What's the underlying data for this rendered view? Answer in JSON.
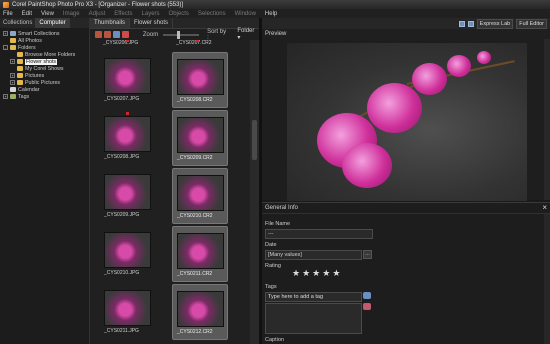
{
  "window": {
    "title": "Corel PaintShop Photo Pro X3 - [Organizer - Flower shots (553)]"
  },
  "menu": [
    "File",
    "Edit",
    "View",
    "Image",
    "Adjust",
    "Effects",
    "Layers",
    "Objects",
    "Selections",
    "Window",
    "Help"
  ],
  "left_panel": {
    "tabs": [
      "Collections",
      "Computer"
    ],
    "tree": [
      {
        "label": "Smart Collections",
        "icon": "collection-icon",
        "expand": "+"
      },
      {
        "label": "All Photos",
        "icon": "folder-icon",
        "expand": ""
      },
      {
        "label": "Folders",
        "icon": "folder-icon",
        "expand": "-"
      },
      {
        "label": "Browse More Folders",
        "icon": "folder-icon",
        "expand": ""
      },
      {
        "label": "Flower shots",
        "icon": "folder-icon",
        "expand": "+"
      },
      {
        "label": "My Corel Shows",
        "icon": "folder-icon",
        "expand": ""
      },
      {
        "label": "Pictures",
        "icon": "folder-icon",
        "expand": "+"
      },
      {
        "label": "Public Pictures",
        "icon": "folder-icon",
        "expand": "+"
      },
      {
        "label": "Calendar",
        "icon": "calendar-icon",
        "expand": ""
      },
      {
        "label": "Tags",
        "icon": "tag-icon",
        "expand": "+"
      }
    ]
  },
  "thumb_panel": {
    "tabs": [
      "Thumbnails",
      "Flower shots"
    ],
    "zoom_label": "Zoom",
    "sort_label": "Sort by :",
    "sort_value": "Folder",
    "top_captions": [
      "_CYS0206.JPG",
      "_CYS0207.CR2"
    ],
    "thumbnails": [
      {
        "caption": "_CYS0207.JPG",
        "selected": false
      },
      {
        "caption": "_CYS0208.CR2",
        "selected": true
      },
      {
        "caption": "_CYS0208.JPG",
        "selected": false
      },
      {
        "caption": "_CYS0209.CR2",
        "selected": true
      },
      {
        "caption": "_CYS0209.JPG",
        "selected": false
      },
      {
        "caption": "_CYS0210.CR2",
        "selected": true
      },
      {
        "caption": "_CYS0210.JPG",
        "selected": false
      },
      {
        "caption": "_CYS0211.CR2",
        "selected": true
      },
      {
        "caption": "_CYS0211.JPG",
        "selected": false
      },
      {
        "caption": "_CYS0212.CR2",
        "selected": true
      }
    ]
  },
  "right_toolbar": {
    "express_lab": "Express Lab",
    "full_editor": "Full Editor"
  },
  "preview": {
    "title": "Preview"
  },
  "info": {
    "title": "General Info",
    "file_name_label": "File Name",
    "file_name_value": "---",
    "date_label": "Date",
    "date_value": "[Many values]",
    "rating_label": "Rating",
    "rating": 5,
    "tags_label": "Tags",
    "tags_placeholder": "Type here to add a tag",
    "caption_label": "Caption"
  },
  "colors": {
    "accent_selected": "#5a5a5a",
    "flower_pink": "#cf2f9a"
  }
}
